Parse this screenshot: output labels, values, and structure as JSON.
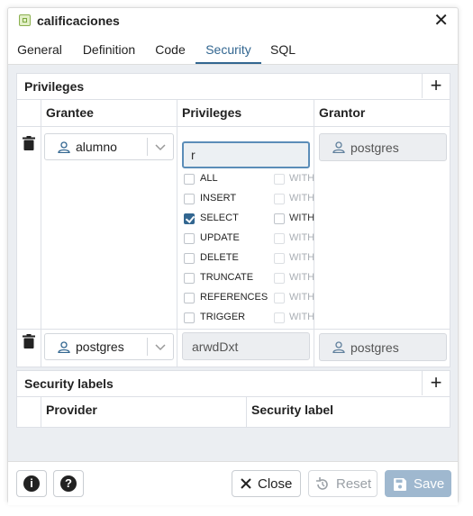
{
  "window": {
    "title": "calificaciones"
  },
  "tabs": [
    {
      "label": "General"
    },
    {
      "label": "Definition"
    },
    {
      "label": "Code"
    },
    {
      "label": "Security",
      "active": true
    },
    {
      "label": "SQL"
    }
  ],
  "privileges": {
    "title": "Privileges",
    "add_symbol": "+",
    "columns": {
      "grantee": "Grantee",
      "privileges": "Privileges",
      "grantor": "Grantor"
    },
    "rows": [
      {
        "grantee": "alumno",
        "privilege_value": "r",
        "grantor": "postgres",
        "options": [
          {
            "label": "ALL",
            "checked": false,
            "with_label": "WITH",
            "with_enabled": false
          },
          {
            "label": "INSERT",
            "checked": false,
            "with_label": "WITH",
            "with_enabled": false
          },
          {
            "label": "SELECT",
            "checked": true,
            "with_label": "WITH",
            "with_enabled": true
          },
          {
            "label": "UPDATE",
            "checked": false,
            "with_label": "WITH",
            "with_enabled": false
          },
          {
            "label": "DELETE",
            "checked": false,
            "with_label": "WITH",
            "with_enabled": false
          },
          {
            "label": "TRUNCATE",
            "checked": false,
            "with_label": "WITH",
            "with_enabled": false
          },
          {
            "label": "REFERENCES",
            "checked": false,
            "with_label": "WITH",
            "with_enabled": false
          },
          {
            "label": "TRIGGER",
            "checked": false,
            "with_label": "WITH",
            "with_enabled": false
          }
        ]
      },
      {
        "grantee": "postgres",
        "privilege_value": "arwdDxt",
        "grantor": "postgres"
      }
    ]
  },
  "security_labels": {
    "title": "Security labels",
    "add_symbol": "+",
    "columns": {
      "provider": "Provider",
      "label": "Security label"
    }
  },
  "footer": {
    "info_glyph": "i",
    "help_glyph": "?",
    "close_label": "Close",
    "reset_label": "Reset",
    "save_label": "Save"
  },
  "colors": {
    "accent": "#326690",
    "content_bg": "#ebeef2",
    "save_bg": "#9fb8cf"
  }
}
